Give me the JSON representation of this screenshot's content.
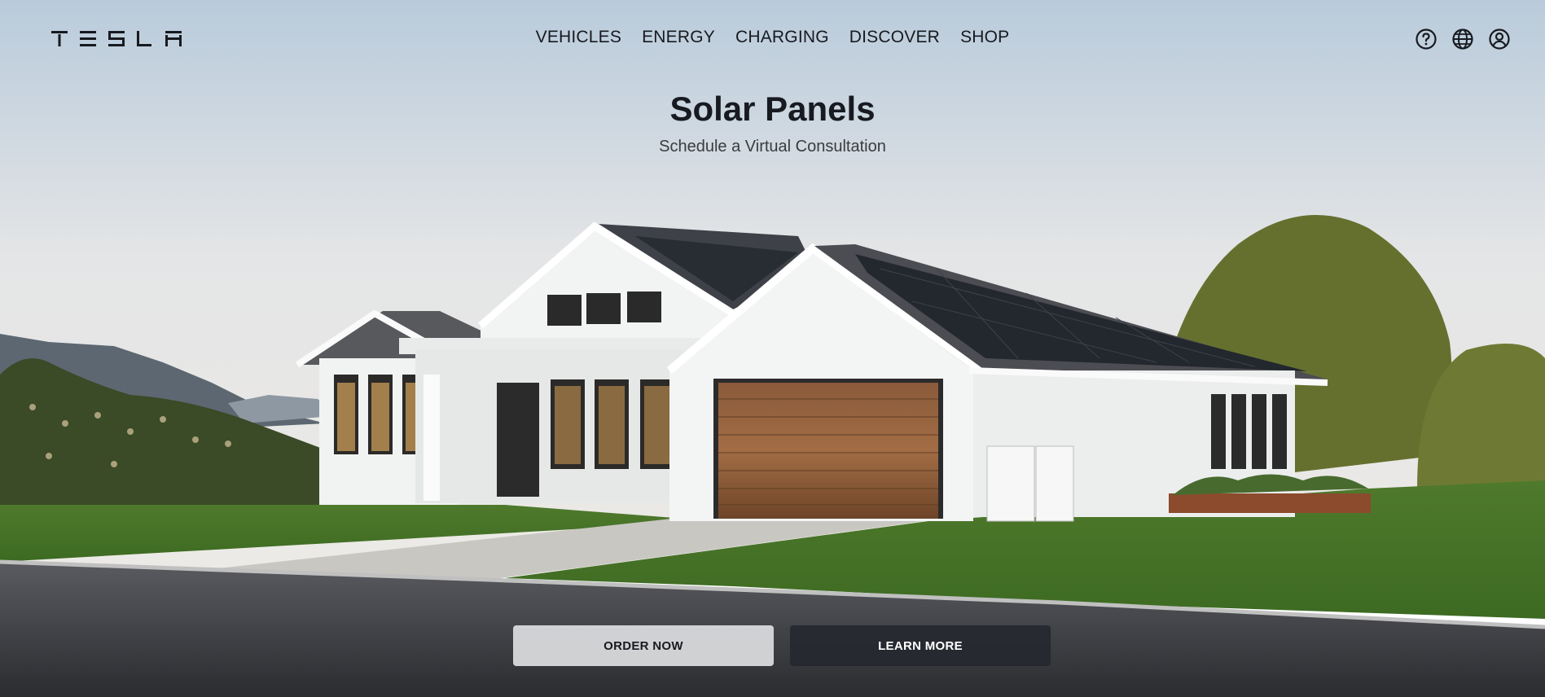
{
  "header": {
    "logo_text": "TESLA",
    "nav": [
      {
        "label": "VEHICLES"
      },
      {
        "label": "ENERGY"
      },
      {
        "label": "CHARGING"
      },
      {
        "label": "DISCOVER"
      },
      {
        "label": "SHOP"
      }
    ],
    "icons": [
      "help-icon",
      "globe-icon",
      "account-icon"
    ]
  },
  "hero": {
    "title": "Solar Panels",
    "subtitle": "Schedule a Virtual Consultation",
    "primary_cta": "ORDER NOW",
    "secondary_cta": "LEARN MORE"
  },
  "colors": {
    "text": "#171a20",
    "light_button": "#dcdddf",
    "dark_button": "#24272e"
  }
}
